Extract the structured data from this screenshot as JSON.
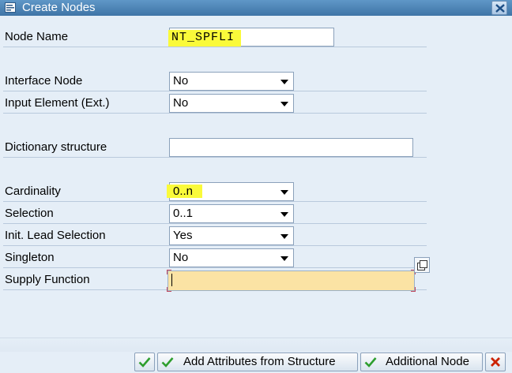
{
  "window": {
    "title": "Create Nodes"
  },
  "form": {
    "node_name": {
      "label": "Node Name",
      "value": "NT_SPFLI"
    },
    "interface_node": {
      "label": "Interface Node",
      "value": "No"
    },
    "input_element": {
      "label": "Input Element (Ext.)",
      "value": "No"
    },
    "dictionary_structure": {
      "label": "Dictionary structure",
      "value": ""
    },
    "cardinality": {
      "label": "Cardinality",
      "value": "0..n"
    },
    "selection": {
      "label": "Selection",
      "value": "0..1"
    },
    "init_lead_selection": {
      "label": "Init. Lead Selection",
      "value": "Yes"
    },
    "singleton": {
      "label": "Singleton",
      "value": "No"
    },
    "supply_function": {
      "label": "Supply Function",
      "value": ""
    }
  },
  "buttons": {
    "ok_label": "",
    "add_attributes_label": "Add Attributes from Structure",
    "additional_node_label": "Additional Node",
    "cancel_label": ""
  },
  "colors": {
    "highlight": "#fafa3a",
    "required_field": "#fbe3a4",
    "titlebar": "#4a80b3",
    "background": "#e5eef7",
    "ok_green": "#2e9e2e",
    "cancel_red": "#cc2200"
  },
  "icons": {
    "title": "window-icon",
    "close": "close-icon",
    "value_help": "value-help-icon",
    "ok": "checkmark-icon",
    "cancel": "cancel-x-icon"
  }
}
